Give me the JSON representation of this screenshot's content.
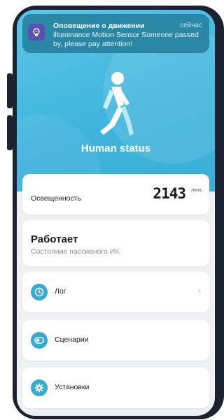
{
  "notification": {
    "title": "Оповещение о движении",
    "time": "сейчас",
    "body": "illuminance Motion Sensor Someone passed by, please pay attention!",
    "icon": "bulb-icon"
  },
  "hero": {
    "title": "Human status",
    "icon": "walking-person-icon"
  },
  "illuminance": {
    "label": "Освещенность",
    "value": "2143",
    "unit": "люкс"
  },
  "status": {
    "main": "Работает",
    "sub": "Состояние пассивного ИК"
  },
  "menu": {
    "log": {
      "label": "Лог",
      "icon": "clock-icon"
    },
    "scenes": {
      "label": "Сценарии",
      "icon": "toggle-icon"
    },
    "settings": {
      "label": "Установки",
      "icon": "gear-icon"
    }
  },
  "colors": {
    "accent": "#36a9d6",
    "hero": "#3fb4dc",
    "notification_icon": "#5b4fb4"
  }
}
